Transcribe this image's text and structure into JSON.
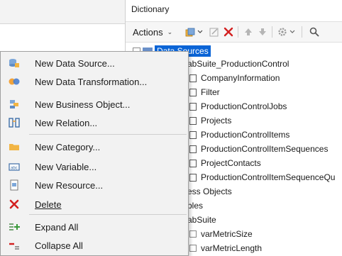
{
  "dictionary": {
    "title": "Dictionary",
    "toolbar": {
      "actions_label": "Actions"
    }
  },
  "tree": {
    "root_label": "Data Sources",
    "items": [
      "abSuite_ProductionControl",
      "CompanyInformation",
      "Filter",
      "ProductionControlJobs",
      "Projects",
      "ProductionControlItems",
      "ProductionControlItemSequences",
      "ProjectContacts",
      "ProductionControlItemSequenceQu",
      "ess Objects",
      "bles",
      "abSuite",
      "varMetricSize",
      "varMetricLength"
    ]
  },
  "context_menu": {
    "items": [
      {
        "label": "New Data Source...",
        "icon": "data-source-icon"
      },
      {
        "label": "New Data Transformation...",
        "icon": "data-transformation-icon"
      },
      {
        "label": "New Business Object...",
        "icon": "business-object-icon"
      },
      {
        "label": "New Relation...",
        "icon": "relation-icon"
      },
      {
        "label": "New Category...",
        "icon": "folder-icon"
      },
      {
        "label": "New Variable...",
        "icon": "variable-icon"
      },
      {
        "label": "New Resource...",
        "icon": "resource-icon"
      },
      {
        "label": "Delete",
        "icon": "delete-icon"
      },
      {
        "label": "Expand All",
        "icon": "expand-all-icon"
      },
      {
        "label": "Collapse All",
        "icon": "collapse-all-icon"
      }
    ]
  },
  "colors": {
    "selection": "#0a64d6",
    "delete_red": "#d32020",
    "menu_bg": "#f2f2f2"
  }
}
